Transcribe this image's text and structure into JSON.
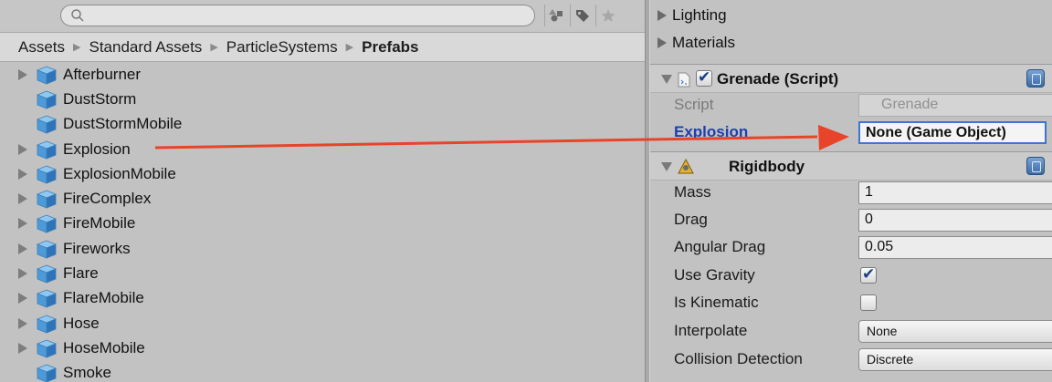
{
  "project": {
    "search": {
      "placeholder": ""
    },
    "toolbar": [
      "filter-by-type-icon",
      "filter-by-label-icon",
      "favorites-star-icon"
    ],
    "breadcrumb": [
      "Assets",
      "Standard Assets",
      "ParticleSystems",
      "Prefabs"
    ],
    "assets": [
      {
        "name": "Afterburner",
        "foldout": true
      },
      {
        "name": "DustStorm",
        "foldout": false
      },
      {
        "name": "DustStormMobile",
        "foldout": false
      },
      {
        "name": "Explosion",
        "foldout": true
      },
      {
        "name": "ExplosionMobile",
        "foldout": true
      },
      {
        "name": "FireComplex",
        "foldout": true
      },
      {
        "name": "FireMobile",
        "foldout": true
      },
      {
        "name": "Fireworks",
        "foldout": true
      },
      {
        "name": "Flare",
        "foldout": true
      },
      {
        "name": "FlareMobile",
        "foldout": true
      },
      {
        "name": "Hose",
        "foldout": true
      },
      {
        "name": "HoseMobile",
        "foldout": true
      },
      {
        "name": "Smoke",
        "foldout": false
      }
    ]
  },
  "inspector": {
    "lighting": "Lighting",
    "materials": "Materials",
    "grenade": {
      "title": "Grenade (Script)",
      "enabled": true,
      "script_label": "Script",
      "script_value": "Grenade",
      "explosion_label": "Explosion",
      "explosion_value": "None (Game Object)"
    },
    "rigidbody": {
      "title": "Rigidbody",
      "mass_label": "Mass",
      "mass": "1",
      "drag_label": "Drag",
      "drag": "0",
      "angular_drag_label": "Angular Drag",
      "angular_drag": "0.05",
      "use_gravity_label": "Use Gravity",
      "use_gravity": true,
      "is_kinematic_label": "Is Kinematic",
      "is_kinematic": false,
      "interpolate_label": "Interpolate",
      "interpolate": "None",
      "collision_label": "Collision Detection",
      "collision": "Discrete"
    }
  },
  "colors": {
    "arrow": "#e8442a",
    "link_label": "#1d3fb0",
    "selection_border": "#3e74d6"
  }
}
